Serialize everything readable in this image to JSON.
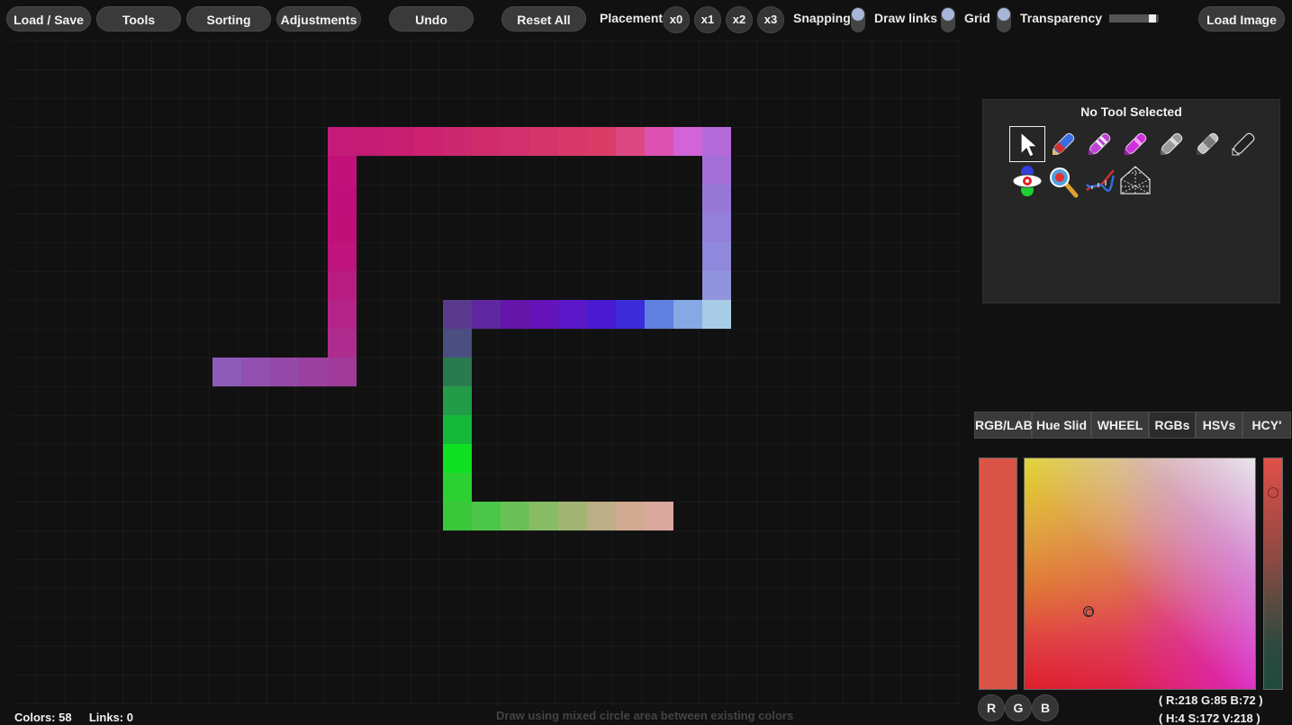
{
  "toolbar": {
    "load_save": "Load / Save",
    "tools": "Tools",
    "sorting": "Sorting",
    "adjustments": "Adjustments",
    "undo": "Undo",
    "reset_all": "Reset All",
    "placement_label": "Placement",
    "placement_options": [
      "x0",
      "x1",
      "x2",
      "x3"
    ],
    "snapping_label": "Snapping",
    "draw_links_label": "Draw links",
    "grid_label": "Grid",
    "transparency_label": "Transparency",
    "transparency_value": 0.95,
    "load_image": "Load Image"
  },
  "tool_panel": {
    "title": "No Tool Selected",
    "tools": [
      {
        "icon": "select-arrow-icon"
      },
      {
        "icon": "red-blue-pen-icon"
      },
      {
        "icon": "magenta-marker-icon"
      },
      {
        "icon": "magenta-marker-2-icon"
      },
      {
        "icon": "gray-marker-icon"
      },
      {
        "icon": "gray-marker-2-icon"
      },
      {
        "icon": "outline-marker-icon"
      },
      {
        "icon": "eye-icon"
      },
      {
        "icon": "magnifier-icon"
      },
      {
        "icon": "dna-icon"
      },
      {
        "icon": "mesh-icon"
      }
    ]
  },
  "tabs": [
    {
      "label": "RGB/LAB",
      "active": false
    },
    {
      "label": "Hue Slid",
      "active": false
    },
    {
      "label": "WHEEL",
      "active": false
    },
    {
      "label": "RGBs",
      "active": true
    },
    {
      "label": "HSVs",
      "active": false
    },
    {
      "label": "HCY'",
      "active": false
    }
  ],
  "picker": {
    "current_color": "#da5548",
    "channel_buttons": [
      "R",
      "G",
      "B"
    ],
    "rgb_readout": "( R:218 G:85 B:72 )",
    "hsv_readout": "( H:4 S:172 V:218 )"
  },
  "status": {
    "colors": "Colors: 58",
    "links": "Links: 0",
    "hint": "Draw using mixed circle area between existing colors"
  },
  "palette_cells": [
    {
      "c": 11,
      "r": 3,
      "color": "#c41a78"
    },
    {
      "c": 12,
      "r": 3,
      "color": "#c41c74"
    },
    {
      "c": 13,
      "r": 3,
      "color": "#c81e72"
    },
    {
      "c": 14,
      "r": 3,
      "color": "#cc2270"
    },
    {
      "c": 15,
      "r": 3,
      "color": "#cc286e"
    },
    {
      "c": 16,
      "r": 3,
      "color": "#d02c6c"
    },
    {
      "c": 17,
      "r": 3,
      "color": "#d2306c"
    },
    {
      "c": 18,
      "r": 3,
      "color": "#d4346a"
    },
    {
      "c": 19,
      "r": 3,
      "color": "#d8386a"
    },
    {
      "c": 20,
      "r": 3,
      "color": "#da3c68"
    },
    {
      "c": 21,
      "r": 3,
      "color": "#dc4880"
    },
    {
      "c": 22,
      "r": 3,
      "color": "#dc52b0"
    },
    {
      "c": 23,
      "r": 3,
      "color": "#d264d8"
    },
    {
      "c": 24,
      "r": 3,
      "color": "#b46ad8"
    },
    {
      "c": 11,
      "r": 4,
      "color": "#c2127a"
    },
    {
      "c": 11,
      "r": 5,
      "color": "#c00e7a"
    },
    {
      "c": 11,
      "r": 6,
      "color": "#c01078"
    },
    {
      "c": 11,
      "r": 7,
      "color": "#be147c"
    },
    {
      "c": 11,
      "r": 8,
      "color": "#b81c80"
    },
    {
      "c": 11,
      "r": 9,
      "color": "#b42488"
    },
    {
      "c": 11,
      "r": 10,
      "color": "#ae2c8e"
    },
    {
      "c": 11,
      "r": 11,
      "color": "#a83496"
    },
    {
      "c": 7,
      "r": 11,
      "color": "#8c5cb8"
    },
    {
      "c": 8,
      "r": 11,
      "color": "#9250b0"
    },
    {
      "c": 9,
      "r": 11,
      "color": "#9448a8"
    },
    {
      "c": 10,
      "r": 11,
      "color": "#9a409e"
    },
    {
      "c": 11,
      "r": 11,
      "color": "#a03a98"
    },
    {
      "c": 24,
      "r": 4,
      "color": "#a470d8"
    },
    {
      "c": 24,
      "r": 5,
      "color": "#9878d6"
    },
    {
      "c": 24,
      "r": 6,
      "color": "#9280da"
    },
    {
      "c": 24,
      "r": 7,
      "color": "#9088dc"
    },
    {
      "c": 24,
      "r": 8,
      "color": "#9094dc"
    },
    {
      "c": 24,
      "r": 9,
      "color": "#98aae0"
    },
    {
      "c": 24,
      "r": 9,
      "color": "#9ab0e0"
    },
    {
      "c": 15,
      "r": 9,
      "color": "#5a3a8c"
    },
    {
      "c": 16,
      "r": 9,
      "color": "#6028a0"
    },
    {
      "c": 17,
      "r": 9,
      "color": "#6416a8"
    },
    {
      "c": 18,
      "r": 9,
      "color": "#6414b8"
    },
    {
      "c": 19,
      "r": 9,
      "color": "#5a18c8"
    },
    {
      "c": 20,
      "r": 9,
      "color": "#4a1ad0"
    },
    {
      "c": 21,
      "r": 9,
      "color": "#3c2cd8"
    },
    {
      "c": 22,
      "r": 9,
      "color": "#6080e0"
    },
    {
      "c": 23,
      "r": 9,
      "color": "#86a8e4"
    },
    {
      "c": 24,
      "r": 9,
      "color": "#a8cce6"
    },
    {
      "c": 15,
      "r": 10,
      "color": "#4a4e80"
    },
    {
      "c": 15,
      "r": 11,
      "color": "#2a7a50"
    },
    {
      "c": 15,
      "r": 12,
      "color": "#229c48"
    },
    {
      "c": 15,
      "r": 13,
      "color": "#16b83a"
    },
    {
      "c": 15,
      "r": 14,
      "color": "#0ee022"
    },
    {
      "c": 15,
      "r": 15,
      "color": "#2cd032"
    },
    {
      "c": 15,
      "r": 16,
      "color": "#3ac83a"
    },
    {
      "c": 16,
      "r": 16,
      "color": "#4cc648"
    },
    {
      "c": 17,
      "r": 16,
      "color": "#6cc058"
    },
    {
      "c": 18,
      "r": 16,
      "color": "#88bc64"
    },
    {
      "c": 19,
      "r": 16,
      "color": "#a4b474"
    },
    {
      "c": 20,
      "r": 16,
      "color": "#bcae86"
    },
    {
      "c": 21,
      "r": 16,
      "color": "#d0aa90"
    },
    {
      "c": 22,
      "r": 16,
      "color": "#daa89c"
    }
  ]
}
